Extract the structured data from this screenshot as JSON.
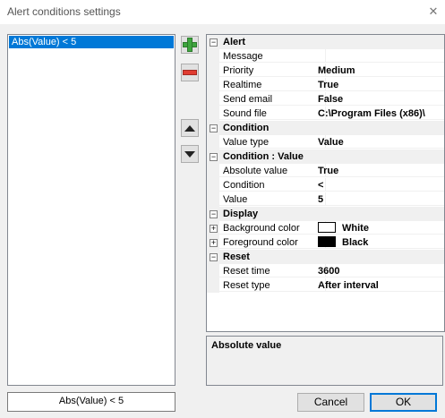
{
  "window": {
    "title": "Alert conditions settings",
    "close_glyph": "✕"
  },
  "alerts": {
    "items": [
      "Abs(Value) < 5"
    ]
  },
  "name_field": {
    "value": "Abs(Value) < 5"
  },
  "icons": {
    "add": "add-icon",
    "remove": "remove-icon",
    "up": "arrow-up-icon",
    "down": "arrow-down-icon"
  },
  "grid": {
    "alert": {
      "label": "Alert",
      "toggle": "−",
      "message": {
        "name": "Message",
        "value": ""
      },
      "priority": {
        "name": "Priority",
        "value": "Medium"
      },
      "realtime": {
        "name": "Realtime",
        "value": "True"
      },
      "send_email": {
        "name": "Send email",
        "value": "False"
      },
      "sound_file": {
        "name": "Sound file",
        "value": "C:\\Program Files (x86)\\"
      }
    },
    "condition": {
      "label": "Condition",
      "toggle": "−",
      "value_type": {
        "name": "Value type",
        "value": "Value"
      }
    },
    "condition_value": {
      "label": "Condition : Value",
      "toggle": "−",
      "absolute_value": {
        "name": "Absolute value",
        "value": "True"
      },
      "condition": {
        "name": "Condition",
        "value": "<"
      },
      "value": {
        "name": "Value",
        "value": "5"
      }
    },
    "display": {
      "label": "Display",
      "toggle": "−",
      "background_color": {
        "name": "Background color",
        "value": "White",
        "color": "#ffffff",
        "toggle": "+"
      },
      "foreground_color": {
        "name": "Foreground color",
        "value": "Black",
        "color": "#000000",
        "toggle": "+"
      }
    },
    "reset": {
      "label": "Reset",
      "toggle": "−",
      "reset_time": {
        "name": "Reset time",
        "value": "3600"
      },
      "reset_type": {
        "name": "Reset type",
        "value": "After interval"
      }
    }
  },
  "description": {
    "title": "Absolute value"
  },
  "buttons": {
    "cancel": "Cancel",
    "ok": "OK"
  }
}
